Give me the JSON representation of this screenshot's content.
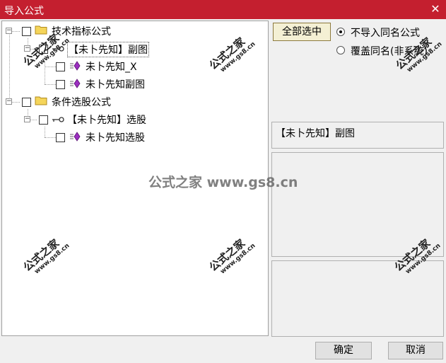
{
  "window": {
    "title": "导入公式",
    "close_glyph": "✕"
  },
  "tree": {
    "nodes": [
      {
        "label": "技术指标公式",
        "type": "folder"
      },
      {
        "label": "【未卜先知】副图",
        "type": "key"
      },
      {
        "label": "未卜先知_X",
        "type": "gem"
      },
      {
        "label": "未卜先知副图",
        "type": "gem"
      },
      {
        "label": "条件选股公式",
        "type": "folder"
      },
      {
        "label": "【未卜先知】选股",
        "type": "key"
      },
      {
        "label": "未卜先知选股",
        "type": "gem"
      }
    ],
    "expander_glyph": "−"
  },
  "options": {
    "select_all_label": "全部选中",
    "radio_skip_label": "不导入同名公式",
    "radio_overwrite_label": "覆盖同名(非系统)",
    "selected_radio": "skip"
  },
  "selected_formula": "【未卜先知】副图",
  "buttons": {
    "ok_label": "确定",
    "cancel_label": "取消"
  },
  "watermarks": {
    "center": "公式之家 www.gs8.cn",
    "stamp_big": "公式之家",
    "stamp_small": "www.gs8.cn"
  },
  "colors": {
    "titlebar": "#c41f2f",
    "gem": "#9b2fc0",
    "folder": "#f5d55a"
  }
}
